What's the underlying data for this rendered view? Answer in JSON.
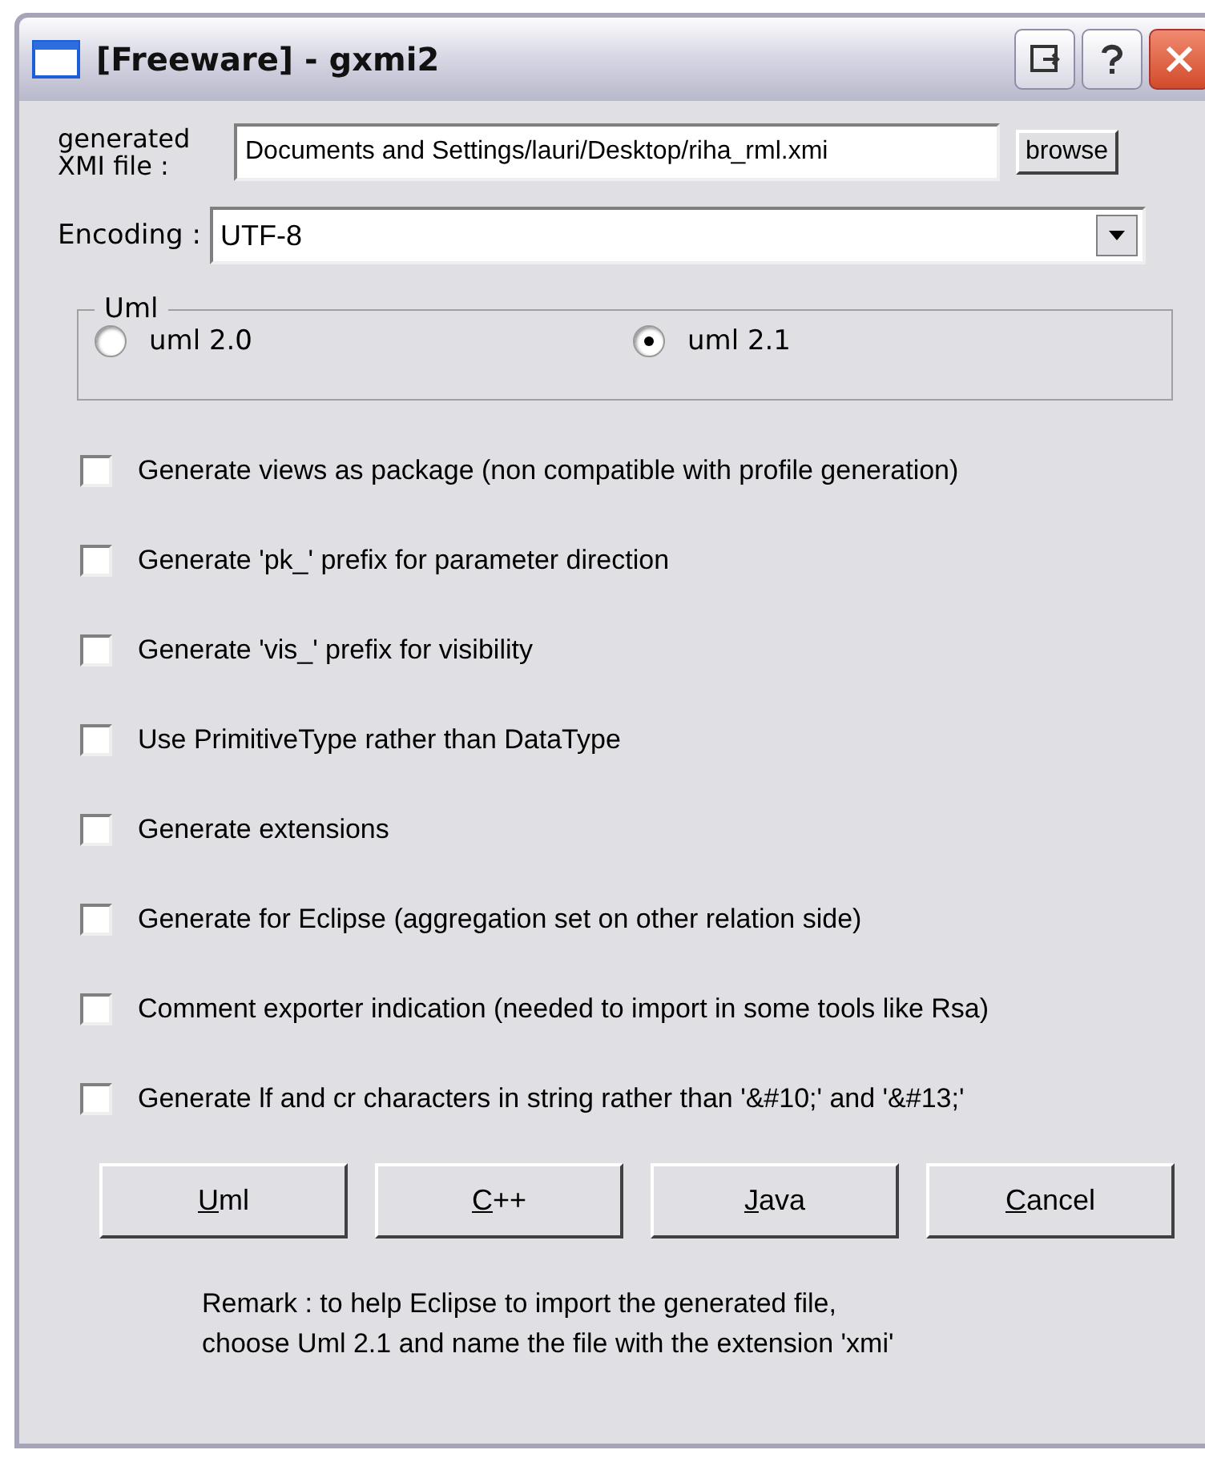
{
  "window": {
    "title": "[Freeware] - gxmi2",
    "controls": [
      {
        "kind": "restore"
      },
      {
        "kind": "help"
      },
      {
        "kind": "close"
      }
    ]
  },
  "file": {
    "label": "generated XMI file :",
    "value": "Documents and Settings/lauri/Desktop/riha_rml.xmi",
    "button": "browse"
  },
  "encoding": {
    "label": "Encoding :",
    "value": "UTF-8"
  },
  "uml": {
    "title": "Uml",
    "options": [
      {
        "label": "uml 2.0",
        "selected": false
      },
      {
        "label": "uml 2.1",
        "selected": true
      }
    ]
  },
  "options": [
    {
      "label": "Generate views as package (non compatible with profile generation)",
      "checked": false
    },
    {
      "label": "Generate 'pk_' prefix for parameter direction",
      "checked": false
    },
    {
      "label": "Generate 'vis_' prefix for visibility",
      "checked": false
    },
    {
      "label": "Use PrimitiveType rather than DataType",
      "checked": false
    },
    {
      "label": "Generate extensions",
      "checked": false
    },
    {
      "label": "Generate for Eclipse (aggregation set on other relation side)",
      "checked": false
    },
    {
      "label": "Comment exporter indication (needed to import in some tools like Rsa)",
      "checked": false
    },
    {
      "label": "Generate lf and cr characters in string rather than '&#10;' and '&#13;'",
      "checked": false
    }
  ],
  "buttons": [
    "Uml",
    "C++",
    "Java",
    "Cancel"
  ],
  "remark": [
    "Remark : to help Eclipse to import the generated file,",
    "choose Uml 2.1 and name the file with the extension 'xmi'"
  ]
}
